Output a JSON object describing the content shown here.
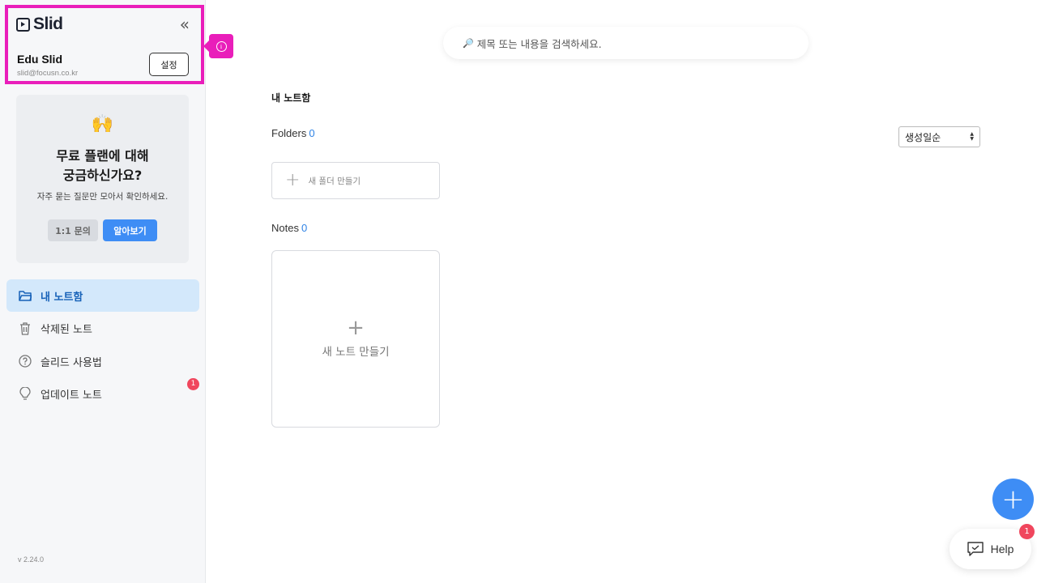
{
  "sidebar": {
    "logo": "Slid",
    "user_name": "Edu Slid",
    "user_email": "slid@focusn.co.kr",
    "settings_label": "설정",
    "promo": {
      "emoji": "🙌",
      "title_line1": "무료 플랜에 대해",
      "title_line2": "궁금하신가요?",
      "subtitle": "자주 묻는 질문만 모아서 확인하세요.",
      "inquiry_label": "1:1 문의",
      "learn_label": "알아보기"
    },
    "items": [
      {
        "label": "내 노트함",
        "icon": "folder-icon",
        "active": true
      },
      {
        "label": "삭제된 노트",
        "icon": "trash-icon"
      },
      {
        "label": "슬리드 사용법",
        "icon": "question-icon"
      },
      {
        "label": "업데이트 노트",
        "icon": "lightbulb-icon",
        "badge": "1"
      }
    ],
    "version": "v 2.24.0"
  },
  "search": {
    "placeholder": "제목 또는 내용을 검색하세요."
  },
  "main": {
    "section_title": "내 노트함",
    "folders_label": "Folders",
    "folders_count": "0",
    "sort_value": "생성일순",
    "new_folder_label": "새 폴더 만들기",
    "notes_label": "Notes",
    "notes_count": "0",
    "new_note_label": "새 노트 만들기"
  },
  "help": {
    "label": "Help",
    "badge": "1"
  },
  "colors": {
    "accent": "#3e8df5",
    "highlight": "#e91eba",
    "badge": "#f0465d",
    "active_bg": "#d3e8fb"
  }
}
